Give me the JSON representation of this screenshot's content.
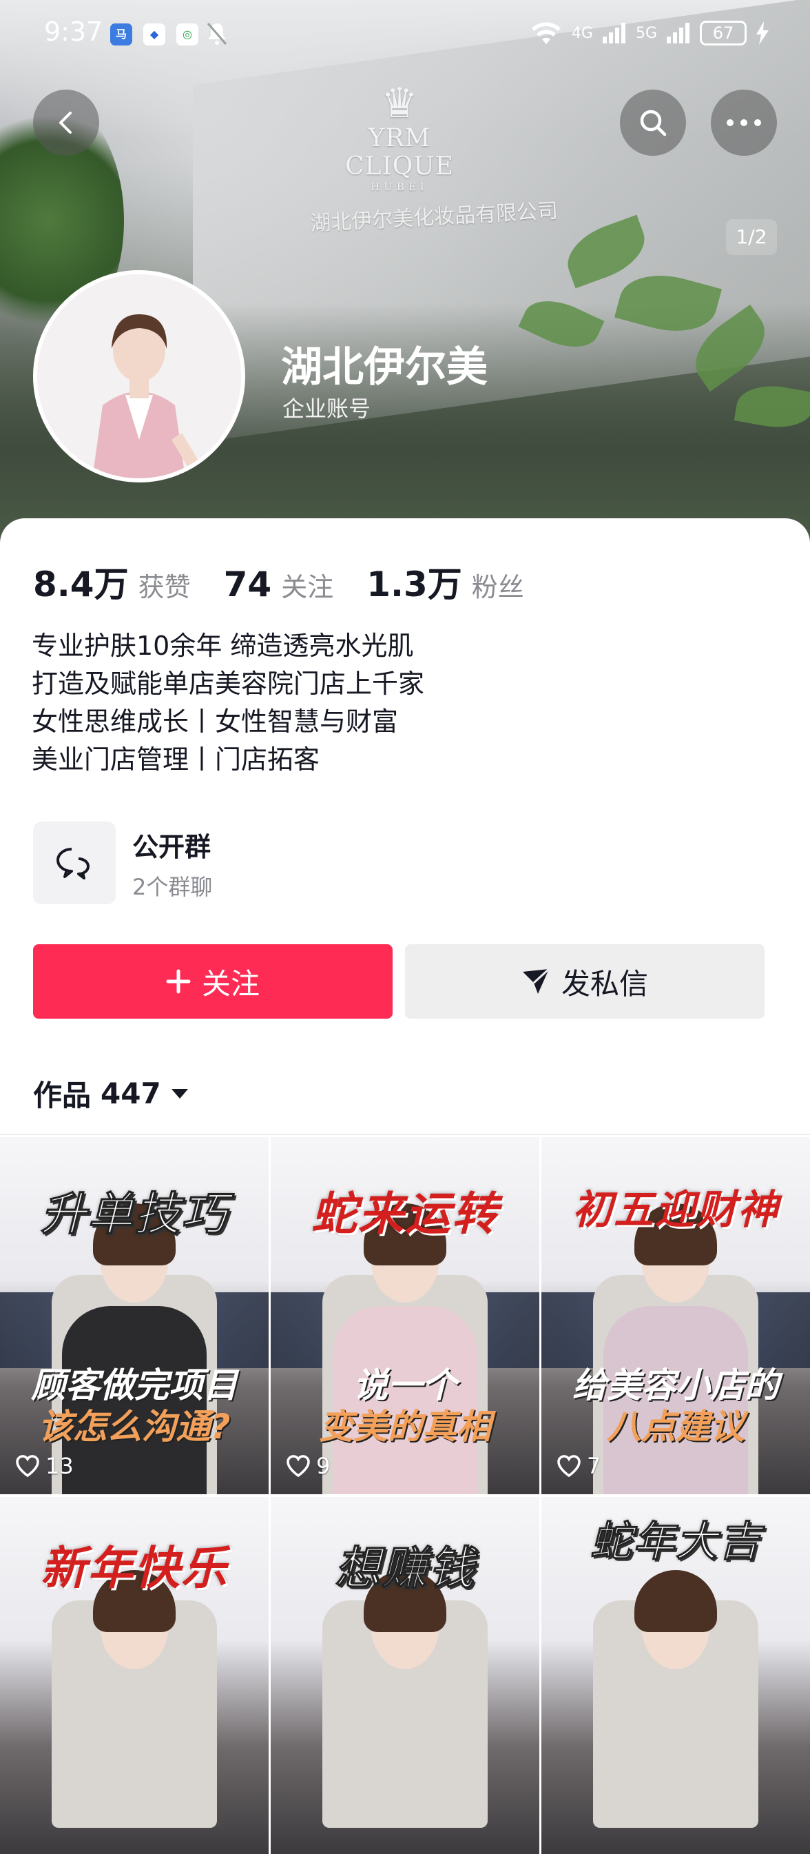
{
  "status_bar": {
    "time": "9:37",
    "network_1": "4G",
    "network_2": "5G",
    "battery": "67"
  },
  "banner": {
    "brand_name": "YRM CLIQUE",
    "brand_sub": "HUBEI",
    "brand_company": "湖北伊尔美化妆品有限公司",
    "page_indicator": "1/2"
  },
  "profile": {
    "name": "湖北伊尔美",
    "account_type": "企业账号"
  },
  "stats": [
    {
      "value": "8.4万",
      "label": "获赞"
    },
    {
      "value": "74",
      "label": "关注"
    },
    {
      "value": "1.3万",
      "label": "粉丝"
    }
  ],
  "bio": [
    "专业护肤10余年 缔造透亮水光肌",
    "打造及赋能单店美容院门店上千家",
    "女性思维成长丨女性智慧与财富",
    "美业门店管理丨门店拓客"
  ],
  "group": {
    "title": "公开群",
    "subtitle": "2个群聊"
  },
  "actions": {
    "follow_label": "关注",
    "message_label": "发私信"
  },
  "works": {
    "label": "作品",
    "count": "447"
  },
  "videos": [
    {
      "title": "升单技巧",
      "caption_1": "顾客做完项目",
      "caption_2": "该怎么沟通?",
      "likes": "13"
    },
    {
      "title": "蛇来运转",
      "caption_1": "说一个",
      "caption_2": "变美的真相",
      "likes": "9"
    },
    {
      "title": "初五迎财神",
      "caption_1": "给美容小店的",
      "caption_2": "八点建议",
      "likes": "7"
    },
    {
      "title": "新年快乐",
      "caption_1": "",
      "caption_2": "",
      "likes": ""
    },
    {
      "title": "想赚钱",
      "caption_1": "",
      "caption_2": "",
      "likes": ""
    },
    {
      "title": "蛇年大吉",
      "caption_1": "",
      "caption_2": "",
      "likes": ""
    }
  ],
  "colors": {
    "accent": "#fe2c55",
    "secondary_button": "#eeeeef",
    "muted_text": "#8a8b91"
  },
  "icons": [
    "back-icon",
    "search-icon",
    "more-icon",
    "group-chat-icon",
    "plus-icon",
    "send-icon",
    "dropdown-icon",
    "heart-icon"
  ]
}
